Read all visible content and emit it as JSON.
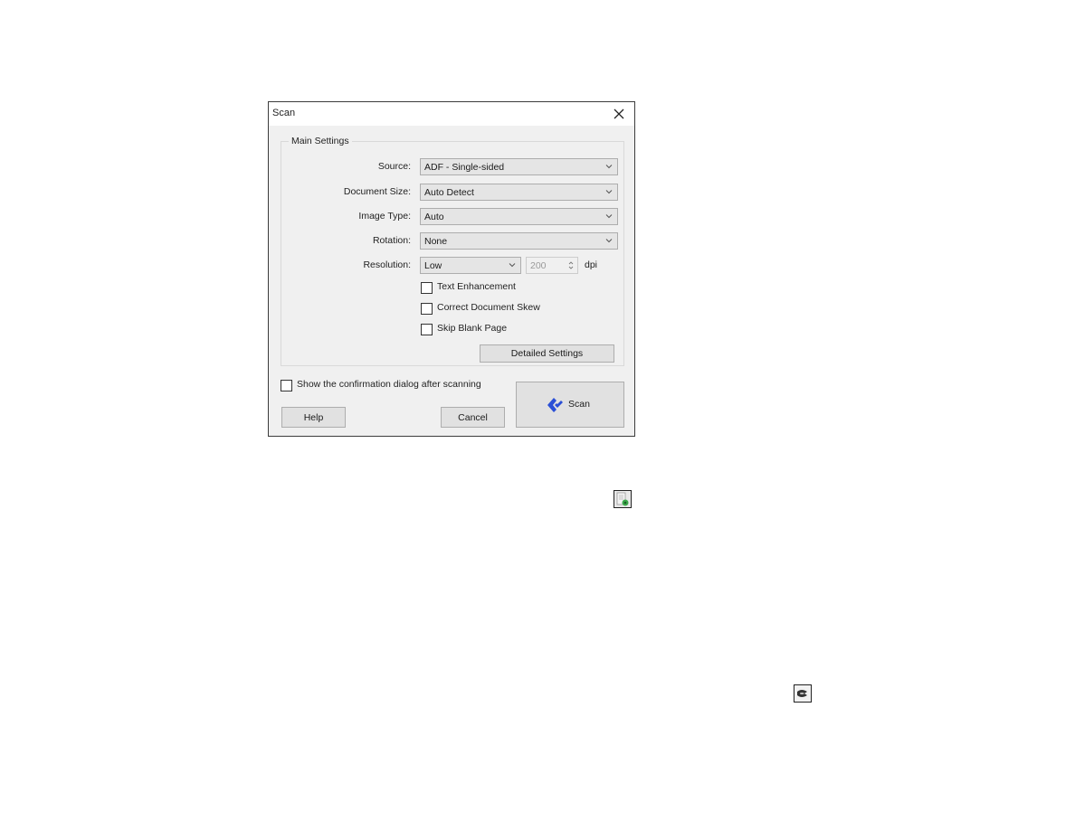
{
  "dialog": {
    "title": "Scan",
    "close_icon": "close-icon",
    "main_settings": {
      "group_label": "Main Settings",
      "source": {
        "label": "Source:",
        "value": "ADF - Single-sided"
      },
      "document_size": {
        "label": "Document Size:",
        "value": "Auto Detect"
      },
      "image_type": {
        "label": "Image Type:",
        "value": "Auto"
      },
      "rotation": {
        "label": "Rotation:",
        "value": "None"
      },
      "resolution": {
        "label": "Resolution:",
        "value": "Low",
        "dpi_value": "200",
        "unit": "dpi"
      },
      "checkboxes": [
        {
          "label": "Text Enhancement",
          "checked": false
        },
        {
          "label": "Correct Document Skew",
          "checked": false
        },
        {
          "label": "Skip Blank Page",
          "checked": false
        }
      ],
      "detailed_settings_label": "Detailed Settings"
    },
    "show_confirmation": {
      "label": "Show the confirmation dialog after scanning",
      "checked": false
    },
    "buttons": {
      "help": "Help",
      "cancel": "Cancel",
      "scan": "Scan"
    },
    "colors": {
      "scan_icon": "#2a4fd6",
      "dialog_bg": "#f0f0f0",
      "button_bg": "#e1e1e1"
    }
  },
  "page_icons": [
    {
      "name": "document-settings-icon"
    },
    {
      "name": "scan-start-icon"
    }
  ]
}
